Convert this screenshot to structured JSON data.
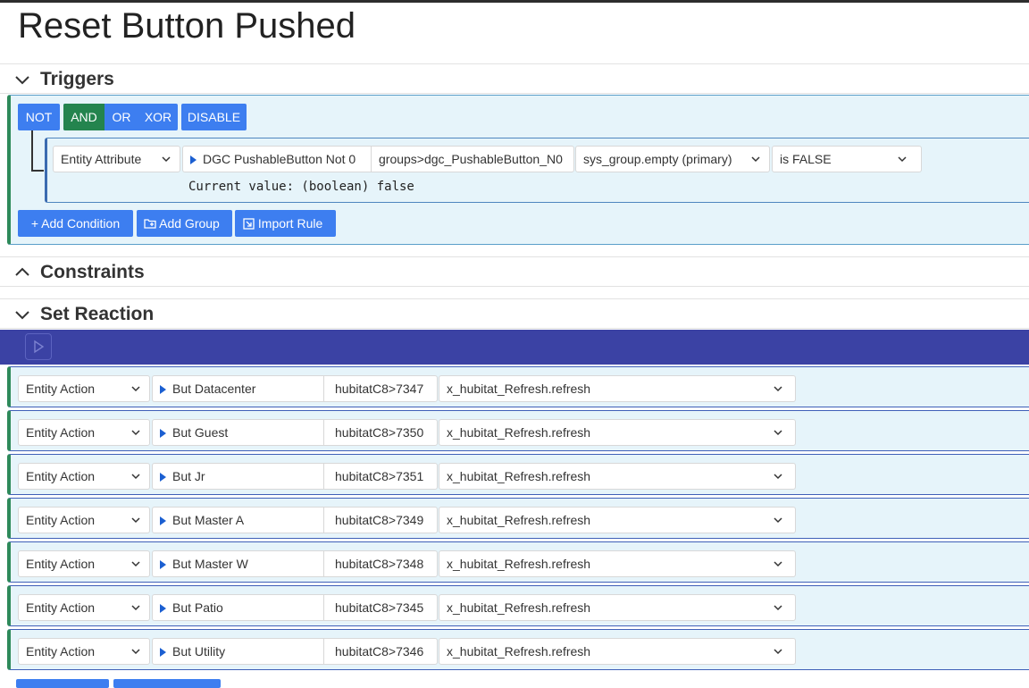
{
  "page": {
    "title": "Reset Button Pushed"
  },
  "sections": {
    "triggers": "Triggers",
    "constraints": "Constraints",
    "reaction": "Set Reaction"
  },
  "triggers": {
    "not_label": "NOT",
    "and_label": "AND",
    "or_label": "OR",
    "xor_label": "XOR",
    "disable_label": "DISABLE",
    "condition": {
      "type": "Entity Attribute",
      "entity": "DGC PushableButton Not 0",
      "entity_id": "groups>dgc_PushableButton_N0",
      "attribute": "sys_group.empty (primary)",
      "operator": "is FALSE",
      "current_value": "Current value: (boolean) false"
    },
    "add_condition_label": "+ Add Condition",
    "add_group_label": "Add Group",
    "import_rule_label": "Import Rule"
  },
  "actions": [
    {
      "type": "Entity Action",
      "entity": "But Datacenter",
      "id": "hubitatC8>7347",
      "action": "x_hubitat_Refresh.refresh"
    },
    {
      "type": "Entity Action",
      "entity": "But Guest",
      "id": "hubitatC8>7350",
      "action": "x_hubitat_Refresh.refresh"
    },
    {
      "type": "Entity Action",
      "entity": "But Jr",
      "id": "hubitatC8>7351",
      "action": "x_hubitat_Refresh.refresh"
    },
    {
      "type": "Entity Action",
      "entity": "But Master A",
      "id": "hubitatC8>7349",
      "action": "x_hubitat_Refresh.refresh"
    },
    {
      "type": "Entity Action",
      "entity": "But Master W",
      "id": "hubitatC8>7348",
      "action": "x_hubitat_Refresh.refresh"
    },
    {
      "type": "Entity Action",
      "entity": "But Patio",
      "id": "hubitatC8>7345",
      "action": "x_hubitat_Refresh.refresh"
    },
    {
      "type": "Entity Action",
      "entity": "But Utility",
      "id": "hubitatC8>7346",
      "action": "x_hubitat_Refresh.refresh"
    }
  ],
  "colors": {
    "primary": "#3d7ef0",
    "and_active": "#24844e",
    "panel_bg": "#e6f4fa",
    "action_bar": "#3b42a4",
    "left_accent": "#2e8a5a"
  }
}
